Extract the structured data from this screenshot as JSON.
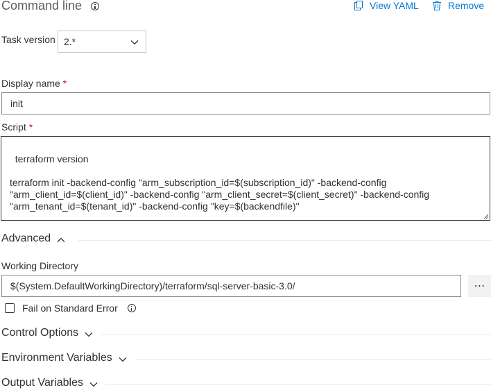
{
  "header": {
    "title": "Command line",
    "view_yaml_label": "View YAML",
    "remove_label": "Remove"
  },
  "task_version": {
    "label": "Task version",
    "value": "2.*"
  },
  "display_name": {
    "label": "Display name",
    "required_mark": "*",
    "value": "init"
  },
  "script": {
    "label": "Script",
    "required_mark": "*",
    "value": "terraform version\n\nterraform init -backend-config \"arm_subscription_id=$(subscription_id)\" -backend-config\n\"arm_client_id=$(client_id)\" -backend-config \"arm_client_secret=$(client_secret)\" -backend-config\n\"arm_tenant_id=$(tenant_id)\" -backend-config \"key=$(backendfile)\""
  },
  "advanced": {
    "label": "Advanced",
    "working_directory": {
      "label": "Working Directory",
      "value": "$(System.DefaultWorkingDirectory)/terraform/sql-server-basic-3.0/",
      "browse_label": "⋯"
    },
    "fail_on_stderr": {
      "label": "Fail on Standard Error",
      "checked": false
    }
  },
  "sections": {
    "control_options": "Control Options",
    "environment_variables": "Environment Variables",
    "output_variables": "Output Variables"
  },
  "colors": {
    "accent": "#0078d4",
    "required": "#a4262c",
    "text": "#323130"
  }
}
